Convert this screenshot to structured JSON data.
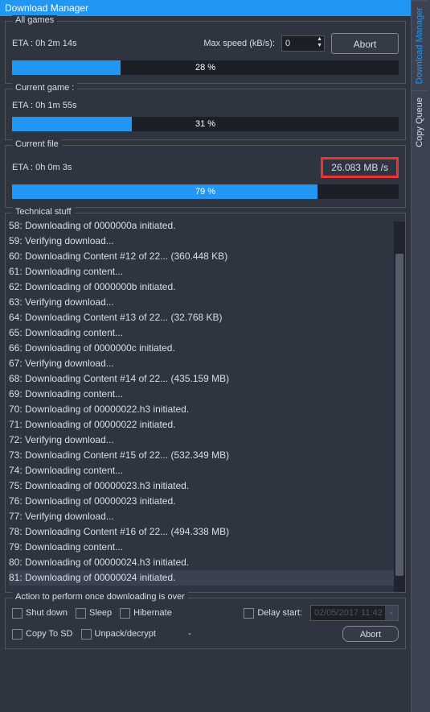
{
  "title": "Download Manager",
  "side_tabs": [
    "Download Manager",
    "Copy Queue"
  ],
  "allgames": {
    "title": "All games",
    "eta": "ETA : 0h 2m 14s",
    "maxspeed_label": "Max speed (kB/s):",
    "maxspeed_value": "0",
    "abort": "Abort",
    "percent": 28,
    "percent_label": "28 %"
  },
  "currentgame": {
    "title": "Current game :",
    "eta": "ETA : 0h 1m 55s",
    "percent": 31,
    "percent_label": "31 %"
  },
  "currentfile": {
    "title": "Current file",
    "eta": "ETA : 0h 0m 3s",
    "speed": "26.083 MB /s",
    "percent": 79,
    "percent_label": "79 %"
  },
  "technical": {
    "title": "Technical stuff",
    "lines": [
      "58: Downloading of 0000000a initiated.",
      "59: Verifying download...",
      "60: Downloading Content #12 of 22... (360.448 KB)",
      "61: Downloading content...",
      "62: Downloading of 0000000b initiated.",
      "63: Verifying download...",
      "64: Downloading Content #13 of 22... (32.768 KB)",
      "65: Downloading content...",
      "66: Downloading of 0000000c initiated.",
      "67: Verifying download...",
      "68: Downloading Content #14 of 22... (435.159 MB)",
      "69: Downloading content...",
      "70: Downloading of 00000022.h3 initiated.",
      "71: Downloading of 00000022 initiated.",
      "72: Verifying download...",
      "73: Downloading Content #15 of 22... (532.349 MB)",
      "74: Downloading content...",
      "75: Downloading of 00000023.h3 initiated.",
      "76: Downloading of 00000023 initiated.",
      "77: Verifying download...",
      "78: Downloading Content #16 of 22... (494.338 MB)",
      "79: Downloading content...",
      "80: Downloading of 00000024.h3 initiated.",
      "81: Downloading of 00000024 initiated."
    ],
    "highlight_index": 23
  },
  "footer": {
    "title": "Action to perform once downloading is over",
    "shutdown": "Shut down",
    "sleep": "Sleep",
    "hibernate": "Hibernate",
    "delaystart": "Delay start:",
    "delay_value": "02/05/2017 11:42",
    "copytosd": "Copy To SD",
    "unpack": "Unpack/decrypt",
    "dash": "-",
    "abort": "Abort"
  }
}
